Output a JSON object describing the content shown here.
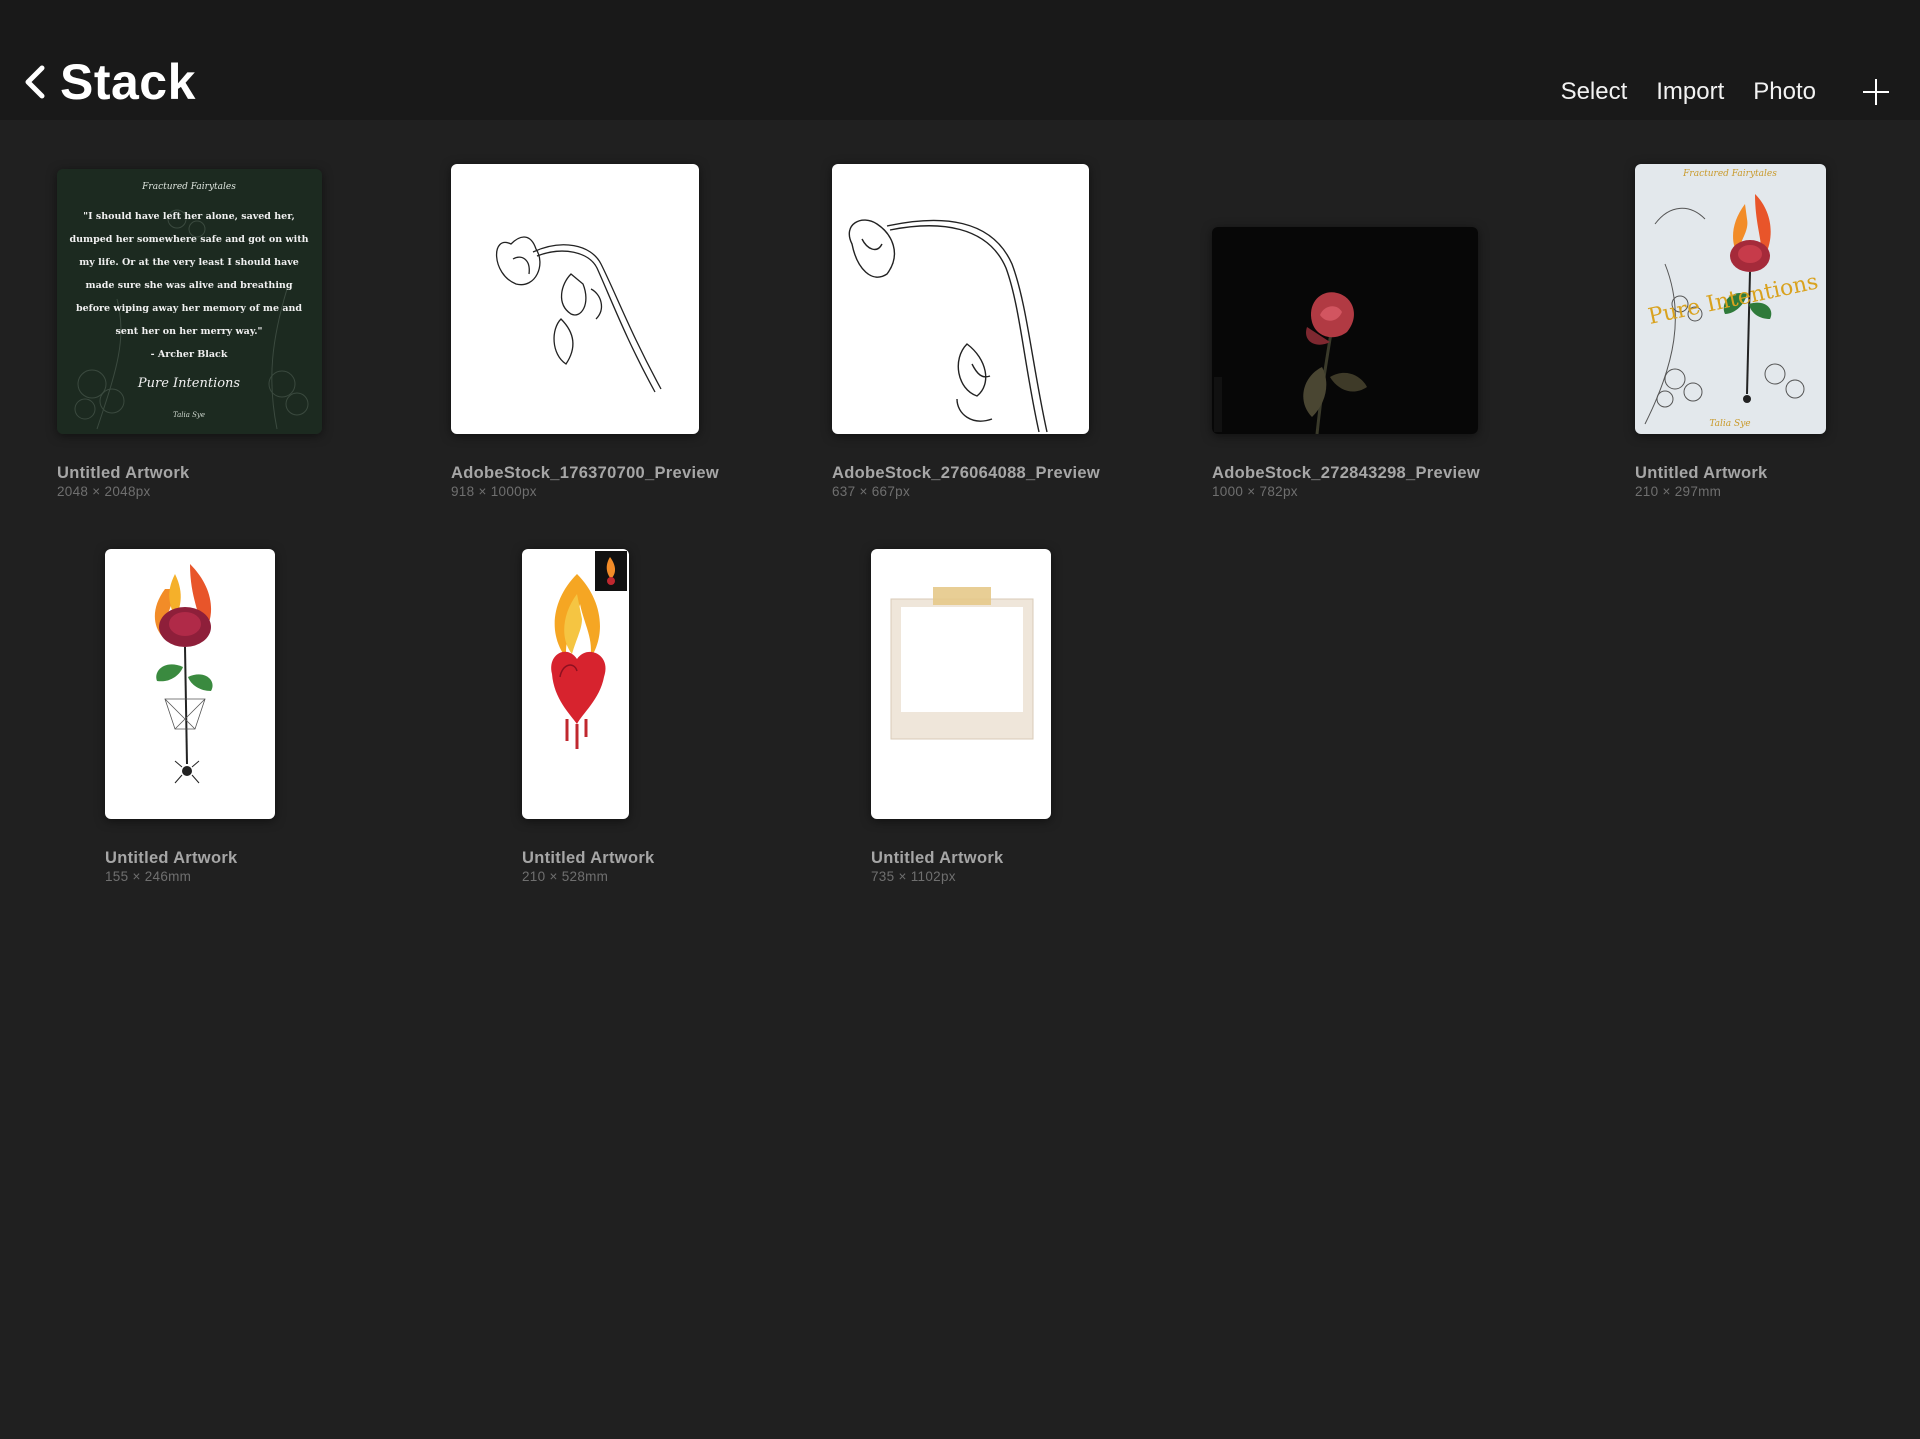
{
  "header": {
    "title": "Stack",
    "actions": {
      "select": "Select",
      "import": "Import",
      "photo": "Photo"
    }
  },
  "gallery": [
    {
      "name": "Untitled Artwork",
      "dims": "2048 × 2048px"
    },
    {
      "name": "AdobeStock_176370700_Preview",
      "dims": "918 × 1000px"
    },
    {
      "name": "AdobeStock_276064088_Preview",
      "dims": "637 × 667px"
    },
    {
      "name": "AdobeStock_272843298_Preview",
      "dims": "1000 × 782px"
    },
    {
      "name": "Untitled Artwork",
      "dims": "210 × 297mm"
    },
    {
      "name": "Untitled Artwork",
      "dims": "155 × 246mm"
    },
    {
      "name": "Untitled Artwork",
      "dims": "210 × 528mm"
    },
    {
      "name": "Untitled Artwork",
      "dims": "735 × 1102px"
    }
  ],
  "thumb_text": {
    "quote_card": {
      "series": "Fractured Fairytales",
      "lines": [
        "\"I should have left her alone, saved her,",
        "dumped her somewhere safe and got on with",
        "my life. Or at the very least I should have",
        "made sure she was alive and breathing",
        "before wiping away her memory of me and",
        "sent her on her merry way.\""
      ],
      "attribution": "- Archer Black",
      "book_title": "Pure Intentions",
      "author": "Talia Sye"
    },
    "cover": {
      "series": "Fractured Fairytales",
      "book_title": "Pure Intentions",
      "author": "Talia Sye"
    }
  },
  "colors": {
    "background": "#202020",
    "topbar": "#191919",
    "label": "#a6a6a6",
    "sublabel": "#6f6f6f"
  }
}
